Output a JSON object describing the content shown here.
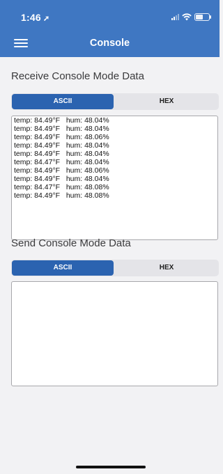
{
  "status_bar": {
    "time": "1:46",
    "location_icon": "location-arrow-icon"
  },
  "navbar": {
    "menu_icon": "hamburger-icon",
    "title": "Console"
  },
  "receive": {
    "title": "Receive Console Mode Data",
    "modes": [
      "ASCII",
      "HEX"
    ],
    "selected": "ASCII",
    "lines": [
      "temp: 84.49°F   hum: 48.04%",
      "temp: 84.49°F   hum: 48.04%",
      "temp: 84.49°F   hum: 48.06%",
      "temp: 84.49°F   hum: 48.04%",
      "temp: 84.49°F   hum: 48.04%",
      "temp: 84.47°F   hum: 48.04%",
      "temp: 84.49°F   hum: 48.06%",
      "temp: 84.49°F   hum: 48.04%",
      "temp: 84.47°F   hum: 48.08%",
      "temp: 84.49°F   hum: 48.08%"
    ]
  },
  "send": {
    "title": "Send Console Mode Data",
    "modes": [
      "ASCII",
      "HEX"
    ],
    "selected": "ASCII",
    "value": ""
  },
  "colors": {
    "accent": "#3f77c2",
    "segment_selected": "#2b63b0",
    "background": "#f2f2f4"
  }
}
